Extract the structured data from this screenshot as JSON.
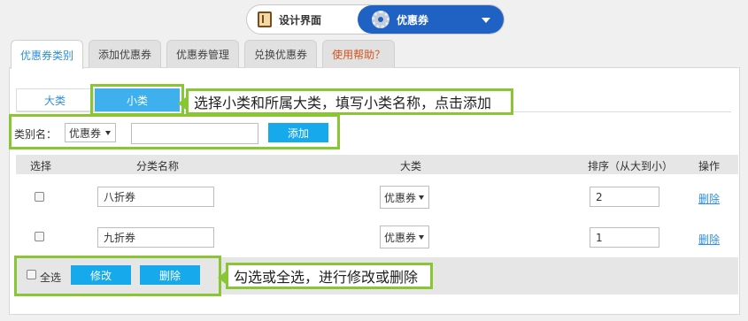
{
  "switcher": {
    "left_label": "设计界面",
    "right_label": "优惠券"
  },
  "tabs": [
    {
      "label": "优惠券类别"
    },
    {
      "label": "添加优惠券"
    },
    {
      "label": "优惠券管理"
    },
    {
      "label": "兑换优惠券"
    },
    {
      "label": "使用帮助？"
    }
  ],
  "subtabs": {
    "da": "大类",
    "xiao": "小类"
  },
  "callouts": {
    "top": "选择小类和所属大类，填写小类名称，点击添加",
    "bottom": "勾选或全选，进行修改或删除"
  },
  "form": {
    "label": "类别名：",
    "category_select": "优惠券",
    "name_value": "",
    "add_button": "添加"
  },
  "table": {
    "headers": {
      "select": "选择",
      "name": "分类名称",
      "category": "大类",
      "sort": "排序（从大到小）",
      "action": "操作"
    },
    "rows": [
      {
        "name": "八折券",
        "category": "优惠券",
        "sort": "2",
        "delete": "删除"
      },
      {
        "name": "九折券",
        "category": "优惠券",
        "sort": "1",
        "delete": "删除"
      }
    ]
  },
  "bottom": {
    "select_all": "全选",
    "modify_button": "修改",
    "delete_button": "删除"
  },
  "colors": {
    "accent_blue": "#16a9ec",
    "switcher_blue": "#1f62c4",
    "highlight_green": "#88c733",
    "help_orange": "#d6521c"
  }
}
